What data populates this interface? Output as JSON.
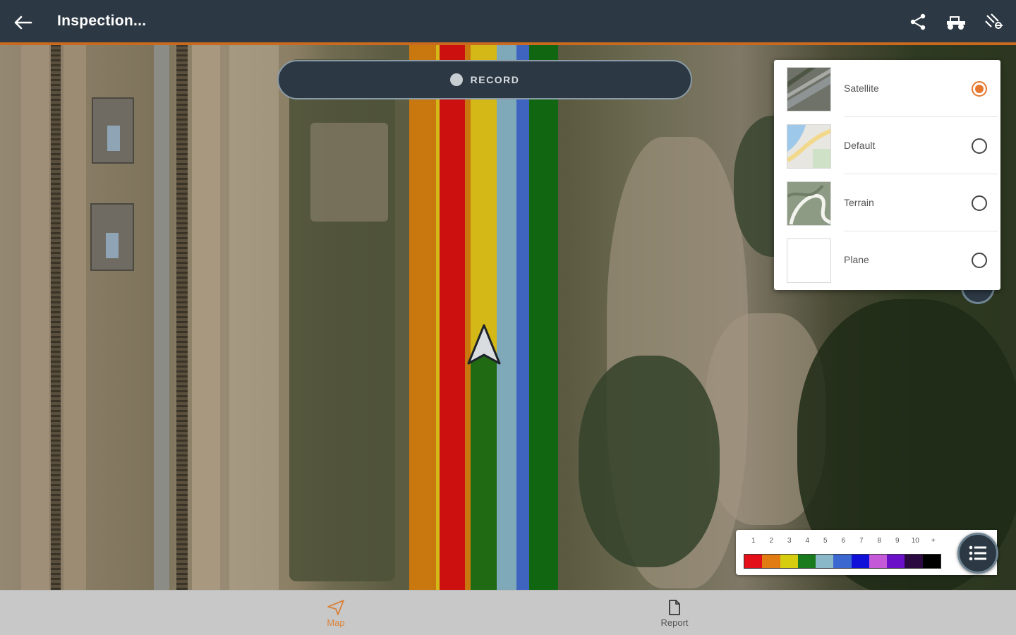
{
  "header": {
    "title": "Inspection...",
    "back_icon": "arrow-left-icon",
    "actions": [
      {
        "name": "share-icon"
      },
      {
        "name": "tractor-icon"
      },
      {
        "name": "sprayer-icon"
      }
    ]
  },
  "record": {
    "label": "RECORD"
  },
  "map_type_panel": {
    "selected": "Satellite",
    "options": [
      {
        "label": "Satellite",
        "selected": true
      },
      {
        "label": "Default",
        "selected": false
      },
      {
        "label": "Terrain",
        "selected": false
      },
      {
        "label": "Plane",
        "selected": false
      }
    ]
  },
  "legend": {
    "numbers": [
      "1",
      "2",
      "3",
      "4",
      "5",
      "6",
      "7",
      "8",
      "9",
      "10",
      "+"
    ],
    "colors": [
      "#e3101a",
      "#e07c12",
      "#d6cc10",
      "#1a7a1e",
      "#8ab8c8",
      "#3a68d0",
      "#1010d8",
      "#c45ad8",
      "#6a10c8",
      "#2a0a40",
      "#000000"
    ]
  },
  "coverage_bands": {
    "colors": [
      "#c97810",
      "#d4b818",
      "#cc1010",
      "#d4b818",
      "#1f6a12",
      "#7fa8b8",
      "#3e64c0",
      "#116611"
    ]
  },
  "bottom_nav": {
    "items": [
      {
        "label": "Map",
        "active": true,
        "icon": "navigation-icon"
      },
      {
        "label": "Report",
        "active": false,
        "icon": "document-icon"
      }
    ],
    "active_color": "#d9823a",
    "inactive_color": "#555555"
  }
}
